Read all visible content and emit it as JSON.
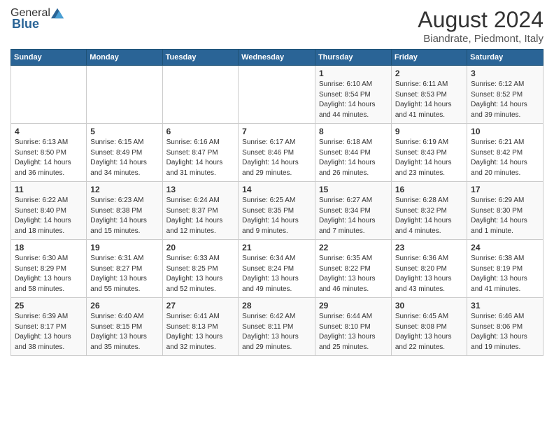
{
  "logo": {
    "general": "General",
    "blue": "Blue"
  },
  "title": {
    "month_year": "August 2024",
    "location": "Biandrate, Piedmont, Italy"
  },
  "days_of_week": [
    "Sunday",
    "Monday",
    "Tuesday",
    "Wednesday",
    "Thursday",
    "Friday",
    "Saturday"
  ],
  "weeks": [
    [
      {
        "day": "",
        "info": ""
      },
      {
        "day": "",
        "info": ""
      },
      {
        "day": "",
        "info": ""
      },
      {
        "day": "",
        "info": ""
      },
      {
        "day": "1",
        "info": "Sunrise: 6:10 AM\nSunset: 8:54 PM\nDaylight: 14 hours and 44 minutes."
      },
      {
        "day": "2",
        "info": "Sunrise: 6:11 AM\nSunset: 8:53 PM\nDaylight: 14 hours and 41 minutes."
      },
      {
        "day": "3",
        "info": "Sunrise: 6:12 AM\nSunset: 8:52 PM\nDaylight: 14 hours and 39 minutes."
      }
    ],
    [
      {
        "day": "4",
        "info": "Sunrise: 6:13 AM\nSunset: 8:50 PM\nDaylight: 14 hours and 36 minutes."
      },
      {
        "day": "5",
        "info": "Sunrise: 6:15 AM\nSunset: 8:49 PM\nDaylight: 14 hours and 34 minutes."
      },
      {
        "day": "6",
        "info": "Sunrise: 6:16 AM\nSunset: 8:47 PM\nDaylight: 14 hours and 31 minutes."
      },
      {
        "day": "7",
        "info": "Sunrise: 6:17 AM\nSunset: 8:46 PM\nDaylight: 14 hours and 29 minutes."
      },
      {
        "day": "8",
        "info": "Sunrise: 6:18 AM\nSunset: 8:44 PM\nDaylight: 14 hours and 26 minutes."
      },
      {
        "day": "9",
        "info": "Sunrise: 6:19 AM\nSunset: 8:43 PM\nDaylight: 14 hours and 23 minutes."
      },
      {
        "day": "10",
        "info": "Sunrise: 6:21 AM\nSunset: 8:42 PM\nDaylight: 14 hours and 20 minutes."
      }
    ],
    [
      {
        "day": "11",
        "info": "Sunrise: 6:22 AM\nSunset: 8:40 PM\nDaylight: 14 hours and 18 minutes."
      },
      {
        "day": "12",
        "info": "Sunrise: 6:23 AM\nSunset: 8:38 PM\nDaylight: 14 hours and 15 minutes."
      },
      {
        "day": "13",
        "info": "Sunrise: 6:24 AM\nSunset: 8:37 PM\nDaylight: 14 hours and 12 minutes."
      },
      {
        "day": "14",
        "info": "Sunrise: 6:25 AM\nSunset: 8:35 PM\nDaylight: 14 hours and 9 minutes."
      },
      {
        "day": "15",
        "info": "Sunrise: 6:27 AM\nSunset: 8:34 PM\nDaylight: 14 hours and 7 minutes."
      },
      {
        "day": "16",
        "info": "Sunrise: 6:28 AM\nSunset: 8:32 PM\nDaylight: 14 hours and 4 minutes."
      },
      {
        "day": "17",
        "info": "Sunrise: 6:29 AM\nSunset: 8:30 PM\nDaylight: 14 hours and 1 minute."
      }
    ],
    [
      {
        "day": "18",
        "info": "Sunrise: 6:30 AM\nSunset: 8:29 PM\nDaylight: 13 hours and 58 minutes."
      },
      {
        "day": "19",
        "info": "Sunrise: 6:31 AM\nSunset: 8:27 PM\nDaylight: 13 hours and 55 minutes."
      },
      {
        "day": "20",
        "info": "Sunrise: 6:33 AM\nSunset: 8:25 PM\nDaylight: 13 hours and 52 minutes."
      },
      {
        "day": "21",
        "info": "Sunrise: 6:34 AM\nSunset: 8:24 PM\nDaylight: 13 hours and 49 minutes."
      },
      {
        "day": "22",
        "info": "Sunrise: 6:35 AM\nSunset: 8:22 PM\nDaylight: 13 hours and 46 minutes."
      },
      {
        "day": "23",
        "info": "Sunrise: 6:36 AM\nSunset: 8:20 PM\nDaylight: 13 hours and 43 minutes."
      },
      {
        "day": "24",
        "info": "Sunrise: 6:38 AM\nSunset: 8:19 PM\nDaylight: 13 hours and 41 minutes."
      }
    ],
    [
      {
        "day": "25",
        "info": "Sunrise: 6:39 AM\nSunset: 8:17 PM\nDaylight: 13 hours and 38 minutes."
      },
      {
        "day": "26",
        "info": "Sunrise: 6:40 AM\nSunset: 8:15 PM\nDaylight: 13 hours and 35 minutes."
      },
      {
        "day": "27",
        "info": "Sunrise: 6:41 AM\nSunset: 8:13 PM\nDaylight: 13 hours and 32 minutes."
      },
      {
        "day": "28",
        "info": "Sunrise: 6:42 AM\nSunset: 8:11 PM\nDaylight: 13 hours and 29 minutes."
      },
      {
        "day": "29",
        "info": "Sunrise: 6:44 AM\nSunset: 8:10 PM\nDaylight: 13 hours and 25 minutes."
      },
      {
        "day": "30",
        "info": "Sunrise: 6:45 AM\nSunset: 8:08 PM\nDaylight: 13 hours and 22 minutes."
      },
      {
        "day": "31",
        "info": "Sunrise: 6:46 AM\nSunset: 8:06 PM\nDaylight: 13 hours and 19 minutes."
      }
    ]
  ]
}
